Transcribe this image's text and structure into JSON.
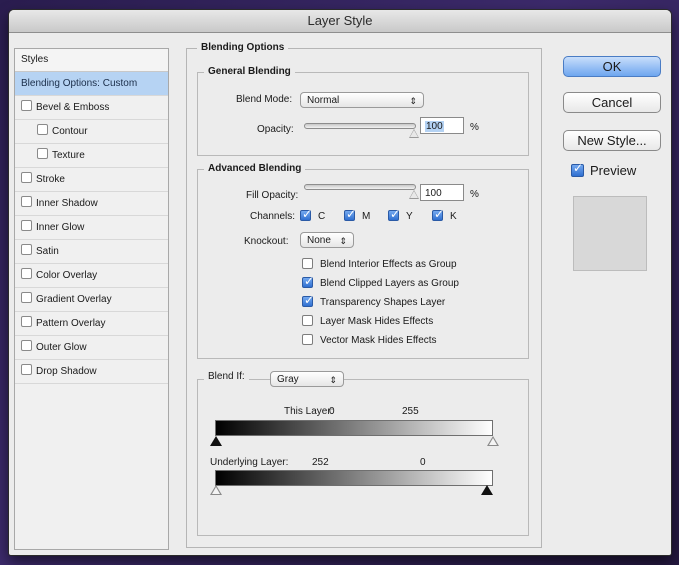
{
  "window": {
    "title": "Layer Style"
  },
  "styles_panel": {
    "header": "Styles",
    "items": [
      {
        "label": "Blending Options: Custom",
        "checkbox": false,
        "selected": true,
        "sub": false
      },
      {
        "label": "Bevel & Emboss",
        "checkbox": true,
        "checked": false,
        "sub": false
      },
      {
        "label": "Contour",
        "checkbox": true,
        "checked": false,
        "sub": true
      },
      {
        "label": "Texture",
        "checkbox": true,
        "checked": false,
        "sub": true
      },
      {
        "label": "Stroke",
        "checkbox": true,
        "checked": false,
        "sub": false
      },
      {
        "label": "Inner Shadow",
        "checkbox": true,
        "checked": false,
        "sub": false
      },
      {
        "label": "Inner Glow",
        "checkbox": true,
        "checked": false,
        "sub": false
      },
      {
        "label": "Satin",
        "checkbox": true,
        "checked": false,
        "sub": false
      },
      {
        "label": "Color Overlay",
        "checkbox": true,
        "checked": false,
        "sub": false
      },
      {
        "label": "Gradient Overlay",
        "checkbox": true,
        "checked": false,
        "sub": false
      },
      {
        "label": "Pattern Overlay",
        "checkbox": true,
        "checked": false,
        "sub": false
      },
      {
        "label": "Outer Glow",
        "checkbox": true,
        "checked": false,
        "sub": false
      },
      {
        "label": "Drop Shadow",
        "checkbox": true,
        "checked": false,
        "sub": false
      }
    ]
  },
  "blending_options": {
    "title": "Blending Options",
    "general": {
      "title": "General Blending",
      "blend_mode_label": "Blend Mode:",
      "blend_mode_value": "Normal",
      "opacity_label": "Opacity:",
      "opacity_value": "100",
      "opacity_unit": "%",
      "opacity_level": 1.0
    },
    "advanced": {
      "title": "Advanced Blending",
      "fill_opacity_label": "Fill Opacity:",
      "fill_opacity_value": "100",
      "fill_opacity_unit": "%",
      "fill_opacity_level": 1.0,
      "channels_label": "Channels:",
      "channels": [
        {
          "label": "C",
          "checked": true
        },
        {
          "label": "M",
          "checked": true
        },
        {
          "label": "Y",
          "checked": true
        },
        {
          "label": "K",
          "checked": true
        }
      ],
      "knockout_label": "Knockout:",
      "knockout_value": "None",
      "options": [
        {
          "label": "Blend Interior Effects as Group",
          "checked": false
        },
        {
          "label": "Blend Clipped Layers as Group",
          "checked": true
        },
        {
          "label": "Transparency Shapes Layer",
          "checked": true
        },
        {
          "label": "Layer Mask Hides Effects",
          "checked": false
        },
        {
          "label": "Vector Mask Hides Effects",
          "checked": false
        }
      ]
    },
    "blend_if": {
      "label": "Blend If:",
      "value": "Gray",
      "this_layer_label": "This Layer:",
      "this_layer_low": "0",
      "this_layer_high": "255",
      "underlying_label": "Underlying Layer:",
      "underlying_low": "252",
      "underlying_high": "0"
    }
  },
  "buttons": {
    "ok": "OK",
    "cancel": "Cancel",
    "new_style": "New Style...",
    "preview_label": "Preview",
    "preview_checked": true
  },
  "colors": {
    "selection": "#b6d3f3",
    "default_button": "#6ea6ef",
    "checkbox_on": "#2f6fd0"
  }
}
